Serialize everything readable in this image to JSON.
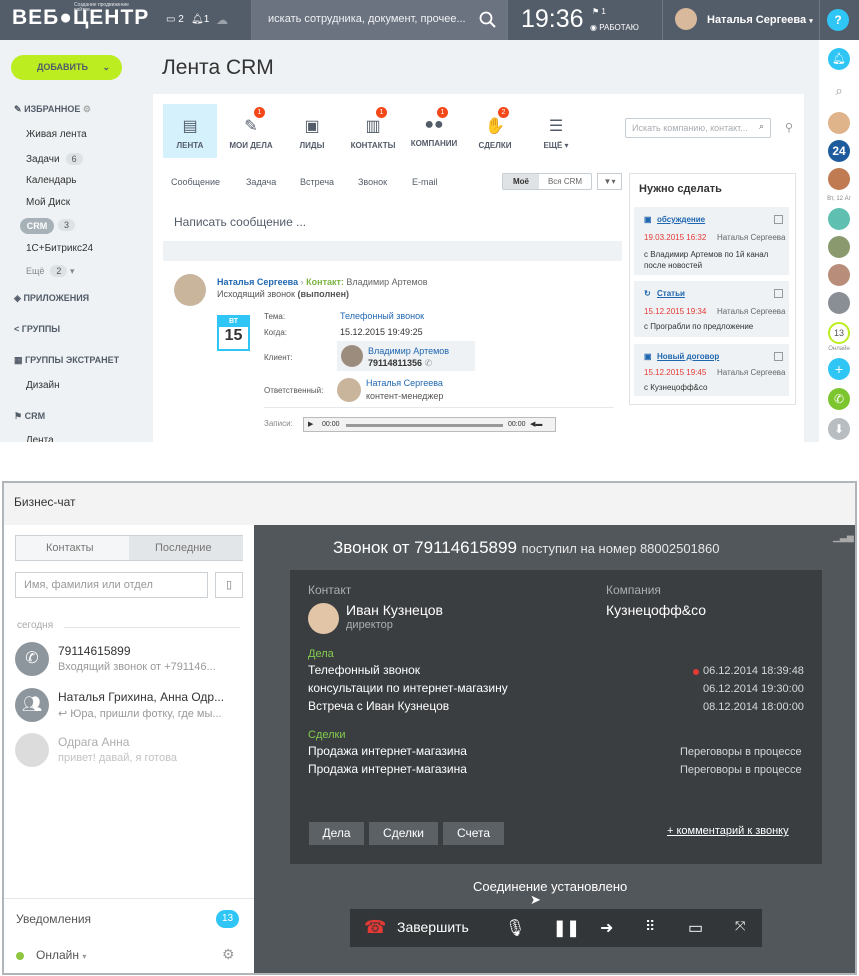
{
  "topbar": {
    "logo": "ВЕБ●ЦЕНТР",
    "logo_sub": "Создание продвижение сайтов",
    "chat_count": "2",
    "notify_count": "1",
    "search_placeholder": "искать сотрудника, документ, прочее...",
    "clock": "19:36",
    "flag_count": "1",
    "work_status": "РАБОТАЮ",
    "user_name": "Наталья Сергеева",
    "help": "?"
  },
  "sidebar": {
    "add_button": "ДОБАВИТЬ",
    "favorites": "ИЗБРАННОЕ",
    "items": [
      {
        "label": "Живая лента"
      },
      {
        "label": "Задачи",
        "count": "6"
      },
      {
        "label": "Календарь"
      },
      {
        "label": "Мой Диск"
      },
      {
        "label": "CRM",
        "count": "3"
      },
      {
        "label": "1С+Битрикс24"
      },
      {
        "label": "Ещё",
        "count": "2"
      }
    ],
    "apps": "ПРИЛОЖЕНИЯ",
    "groups": "ГРУППЫ",
    "extranet": "ГРУППЫ ЭКСТРАНЕТ",
    "design": "Дизайн",
    "crm": "CRM",
    "feed": "Лента"
  },
  "crm": {
    "title": "Лента CRM",
    "tabs": [
      {
        "label": "ЛЕНТА",
        "icon": "document-icon"
      },
      {
        "label": "МОИ ДЕЛА",
        "badge": "1",
        "icon": "checklist-icon"
      },
      {
        "label": "ЛИДЫ",
        "icon": "lead-icon"
      },
      {
        "label": "КОНТАКТЫ",
        "badge": "1",
        "icon": "contact-icon"
      },
      {
        "label": "КОМПАНИИ",
        "badge": "1",
        "icon": "company-icon"
      },
      {
        "label": "СДЕЛКИ",
        "badge": "2",
        "icon": "handshake-icon"
      },
      {
        "label": "ЕЩЁ",
        "icon": "list-icon"
      }
    ],
    "search_placeholder": "Искать компанию, контакт...",
    "subtabs": [
      "Сообщение",
      "Задача",
      "Встреча",
      "Звонок",
      "E-mail"
    ],
    "filter_mine": "Моё",
    "filter_all": "Вся CRM",
    "compose_placeholder": "Написать сообщение ...",
    "post": {
      "author": "Наталья Сергеева",
      "contact_label": "Контакт:",
      "contact_name": "Владимир Артемов",
      "type": "Исходящий звонок",
      "status": "(выполнен)",
      "day_name": "ВТ",
      "day": "15",
      "topic_label": "Тема:",
      "topic": "Телефонный звонок",
      "when_label": "Когда:",
      "when": "15.12.2015 19:49:25",
      "client_label": "Клиент:",
      "client_name": "Владимир Артемов",
      "client_phone": "79114811356",
      "responsible_label": "Ответственный:",
      "responsible_name": "Наталья Сергеева",
      "responsible_role": "контент-менеджер",
      "records_label": "Записи:",
      "time_start": "00:00",
      "time_end": "00:00"
    }
  },
  "todo": {
    "title": "Нужно сделать",
    "items": [
      {
        "title": "обсуждение",
        "date": "19.03.2015 16:32",
        "person": "Наталья Сергеева",
        "text": "с Владимир Артемов по 1й канал после новостей"
      },
      {
        "title": "Статьи",
        "date": "15.12.2015 19:34",
        "person": "Наталья Сергеева",
        "text": "с Програбли по предложение"
      },
      {
        "title": "Новый договор",
        "date": "15.12.2015 19:45",
        "person": "Наталья Сергеева",
        "text": "с Кузнецофф&со"
      }
    ]
  },
  "right_strip": {
    "date": "Вт, 12 Аг",
    "count": "24",
    "online_count": "13",
    "online": "Онлайн"
  },
  "chat": {
    "title": "Бизнес-чат",
    "tab_contacts": "Контакты",
    "tab_recent": "Последние",
    "search_placeholder": "Имя, фамилия или отдел",
    "section_today": "сегодня",
    "items": [
      {
        "name": "79114615899",
        "sub": "Входящий звонок от +791146..."
      },
      {
        "name": "Наталья Грихина, Анна Одр...",
        "sub": "↩ Юра, пришли фотку, где мы..."
      },
      {
        "name": "Одрага Анна",
        "sub": "привет! давай, я готова"
      }
    ],
    "notifications": "Уведомления",
    "notifications_count": "13",
    "status": "Онлайн"
  },
  "call": {
    "title": "Звонок от 79114615899",
    "subtitle": "поступил на номер 88002501860",
    "contact_label": "Контакт",
    "company_label": "Компания",
    "contact_name": "Иван Кузнецов",
    "contact_role": "директор",
    "company_name": "Кузнецофф&со",
    "activities_label": "Дела",
    "activities": [
      {
        "name": "Телефонный звонок",
        "date": "06.12.2014 18:39:48"
      },
      {
        "name": "консультации по интернет-магазину",
        "date": "06.12.2014 19:30:00"
      },
      {
        "name": "Встреча с Иван Кузнецов",
        "date": "08.12.2014 18:00:00"
      }
    ],
    "deals_label": "Сделки",
    "deals": [
      {
        "name": "Продажа интернет-магазина",
        "status": "Переговоры в процессе"
      },
      {
        "name": "Продажа интернет-магазина",
        "status": "Переговоры в процессе"
      }
    ],
    "btn_activities": "Дела",
    "btn_deals": "Сделки",
    "btn_invoices": "Счета",
    "comment_link": "+ комментарий к звонку",
    "connection_status": "Соединение установлено",
    "hangup": "Завершить"
  }
}
